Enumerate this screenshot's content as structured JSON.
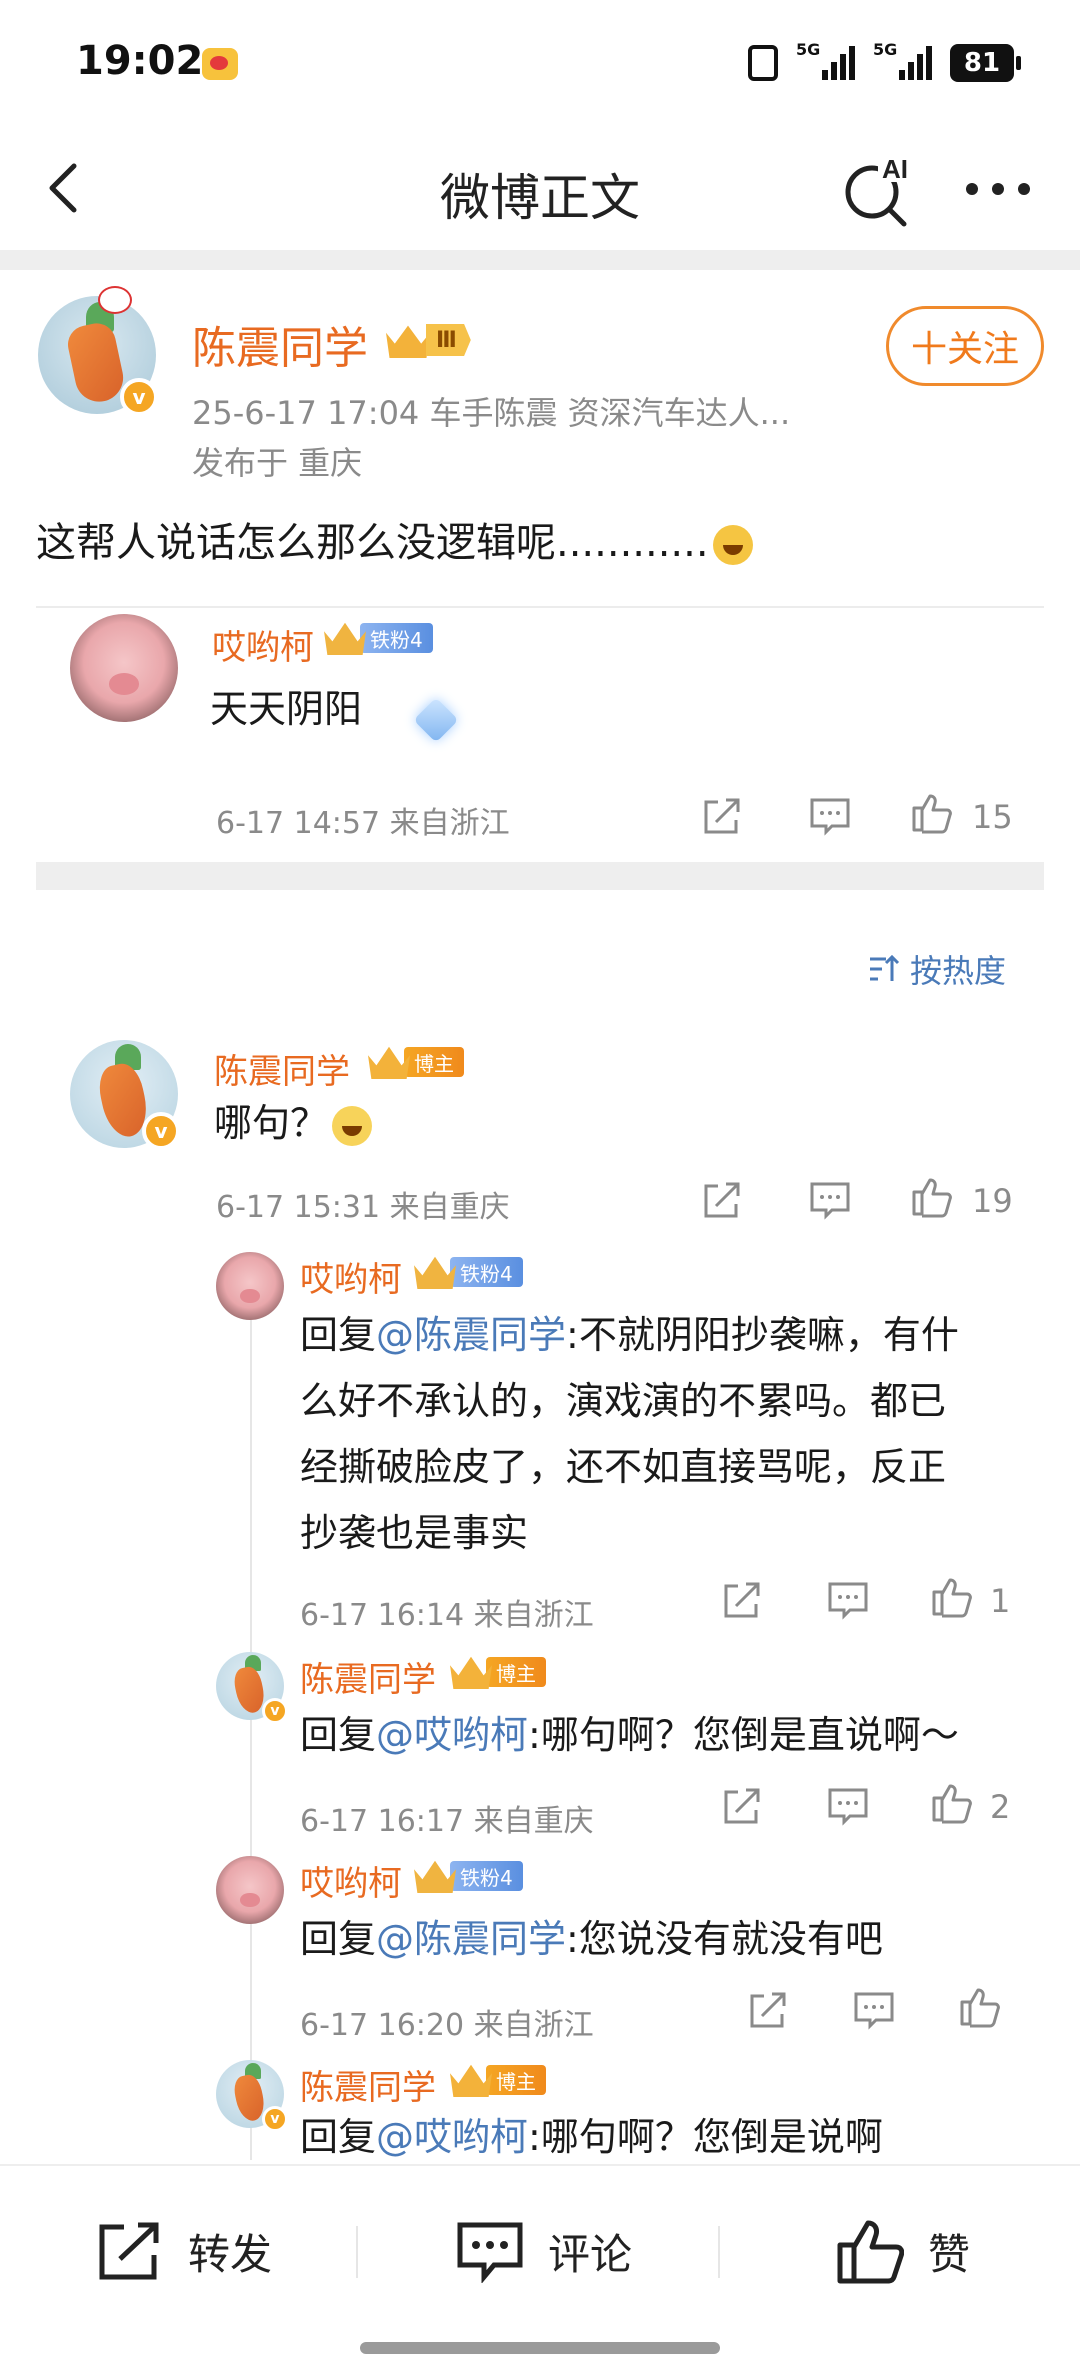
{
  "status_bar": {
    "time": "19:02",
    "signal1": "5G",
    "signal2": "5G",
    "battery": "81"
  },
  "nav": {
    "title": "微博正文",
    "ai_label": "AI"
  },
  "post": {
    "author": "陈震同学",
    "level": "Ⅲ",
    "meta": "25-6-17 17:04   车手陈震 资深汽车达人...",
    "location": "发布于 重庆",
    "follow": "十关注",
    "text": "这帮人说话怎么那么没逻辑呢............"
  },
  "hot_comment": {
    "user": "哎哟柯",
    "fan_badge": "铁粉4",
    "text": "天天阴阳",
    "time": "6-17 14:57  来自浙江",
    "likes": "15"
  },
  "sort_label": "按热度",
  "comments": [
    {
      "user": "陈震同学",
      "badge": "博主",
      "text": "哪句？",
      "time": "6-17 15:31  来自重庆",
      "likes": "19"
    }
  ],
  "replies": [
    {
      "user": "哎哟柯",
      "badge": "铁粉4",
      "prefix": "回复",
      "mention": "@陈震同学",
      "line1": ":不就阴阳抄袭嘛，有什",
      "line2": "么好不承认的，演戏演的不累吗。都已",
      "line3": "经撕破脸皮了，还不如直接骂呢，反正",
      "line4": "抄袭也是事实",
      "time": "6-17 16:14  来自浙江",
      "likes": "1"
    },
    {
      "user": "陈震同学",
      "badge": "博主",
      "prefix": "回复",
      "mention": "@哎哟柯",
      "line1": ":哪句啊？您倒是直说啊～",
      "time": "6-17 16:17  来自重庆",
      "likes": "2"
    },
    {
      "user": "哎哟柯",
      "badge": "铁粉4",
      "prefix": "回复",
      "mention": "@陈震同学",
      "line1": ":您说没有就没有吧",
      "time": "6-17 16:20  来自浙江",
      "likes": ""
    },
    {
      "user": "陈震同学",
      "badge": "博主",
      "prefix": "回复",
      "mention": "@哎哟柯",
      "line1": ":哪句啊？您倒是说啊"
    }
  ],
  "bottom_bar": {
    "repost": "转发",
    "comment": "评论",
    "like": "赞"
  },
  "colors": {
    "name_orange": "#e86a21",
    "mention_blue": "#4a7ab8",
    "meta_gray": "#8a8a8a"
  }
}
